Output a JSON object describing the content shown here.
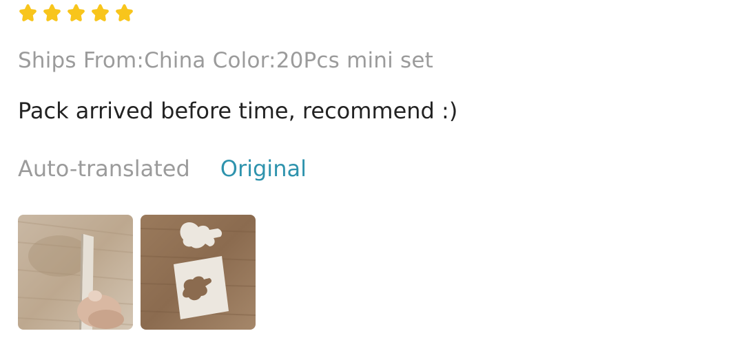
{
  "rating": {
    "value": 5,
    "max": 5,
    "star_color": "#f8c51c",
    "icon": "star-icon"
  },
  "meta": {
    "ships_from_label": "Ships From:",
    "ships_from_value": "China",
    "color_label": "Color:",
    "color_value": "20Pcs mini set"
  },
  "review_text": "Pack arrived before time, recommend :)",
  "translation": {
    "auto_label": "Auto-translated",
    "original_link": "Original"
  },
  "colors": {
    "meta_text": "#9b9b9b",
    "body_text": "#222222",
    "link": "#2e93ad"
  },
  "photos": [
    {
      "icon": "photo-thumbnail-stencil-edge"
    },
    {
      "icon": "photo-thumbnail-stencil-cutout"
    }
  ]
}
